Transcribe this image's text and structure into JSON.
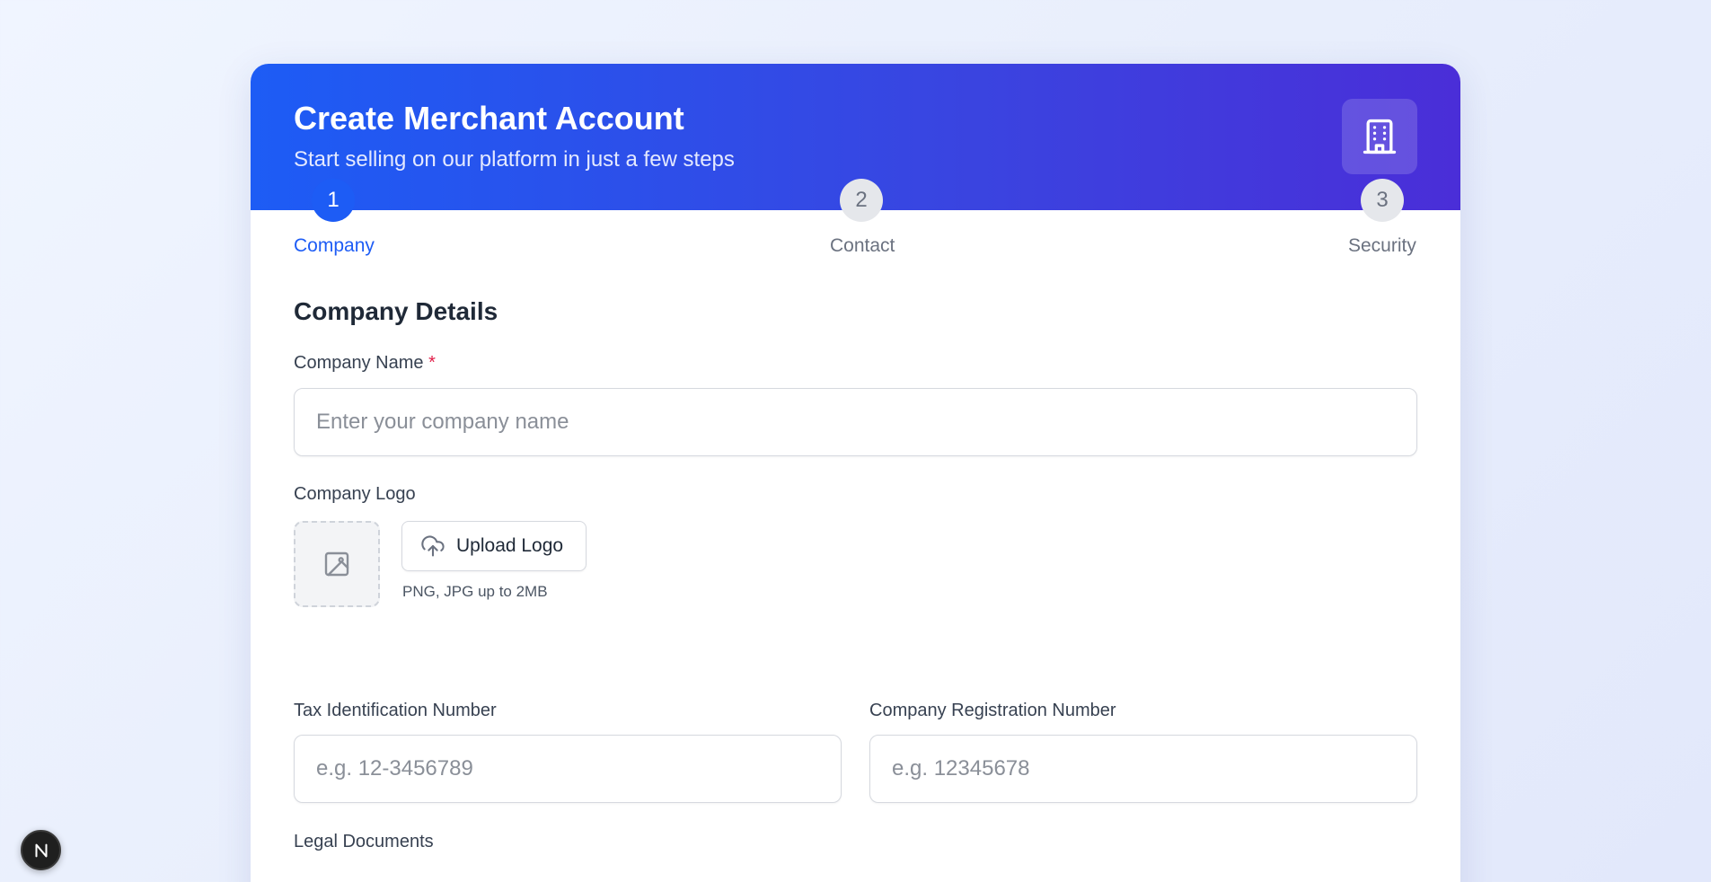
{
  "header": {
    "title": "Create Merchant Account",
    "subtitle": "Start selling on our platform in just a few steps",
    "icon": "building-icon"
  },
  "steps": [
    {
      "number": "1",
      "label": "Company",
      "active": true
    },
    {
      "number": "2",
      "label": "Contact",
      "active": false
    },
    {
      "number": "3",
      "label": "Security",
      "active": false
    }
  ],
  "form": {
    "section_title": "Company Details",
    "company_name": {
      "label": "Company Name",
      "required_mark": "*",
      "placeholder": "Enter your company name",
      "value": ""
    },
    "company_logo": {
      "label": "Company Logo",
      "upload_label": "Upload Logo",
      "hint": "PNG, JPG up to 2MB"
    },
    "tax_id": {
      "label": "Tax Identification Number",
      "placeholder": "e.g. 12-3456789",
      "value": ""
    },
    "registration_number": {
      "label": "Company Registration Number",
      "placeholder": "e.g. 12345678",
      "value": ""
    },
    "legal_documents": {
      "label": "Legal Documents"
    }
  },
  "colors": {
    "accent": "#1d5cf5",
    "header_gradient_end": "#4a2ed8",
    "inactive_step": "#e5e7eb",
    "required": "#e11d48"
  },
  "badge": {
    "letter": "N"
  }
}
